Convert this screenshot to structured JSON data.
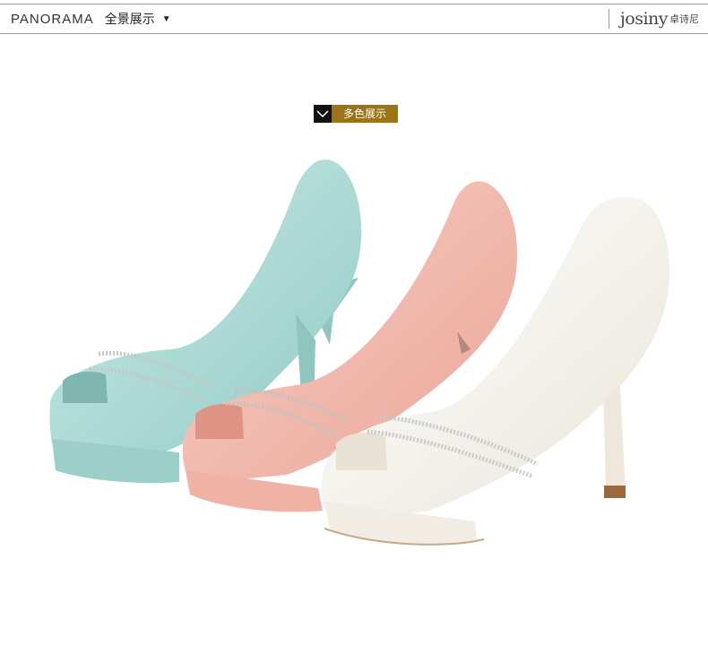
{
  "header": {
    "title_en": "PANORAMA",
    "title_cn": "全景展示",
    "caret": "▼",
    "brand_en": "JOSINY",
    "brand_cn": "卓诗尼"
  },
  "badge": {
    "label": "多色展示"
  },
  "colors": {
    "accent": "#9b7418",
    "shoe_blue": "#a9d8d3",
    "shoe_pink": "#f4b7ad",
    "shoe_white": "#f7f5ef"
  }
}
